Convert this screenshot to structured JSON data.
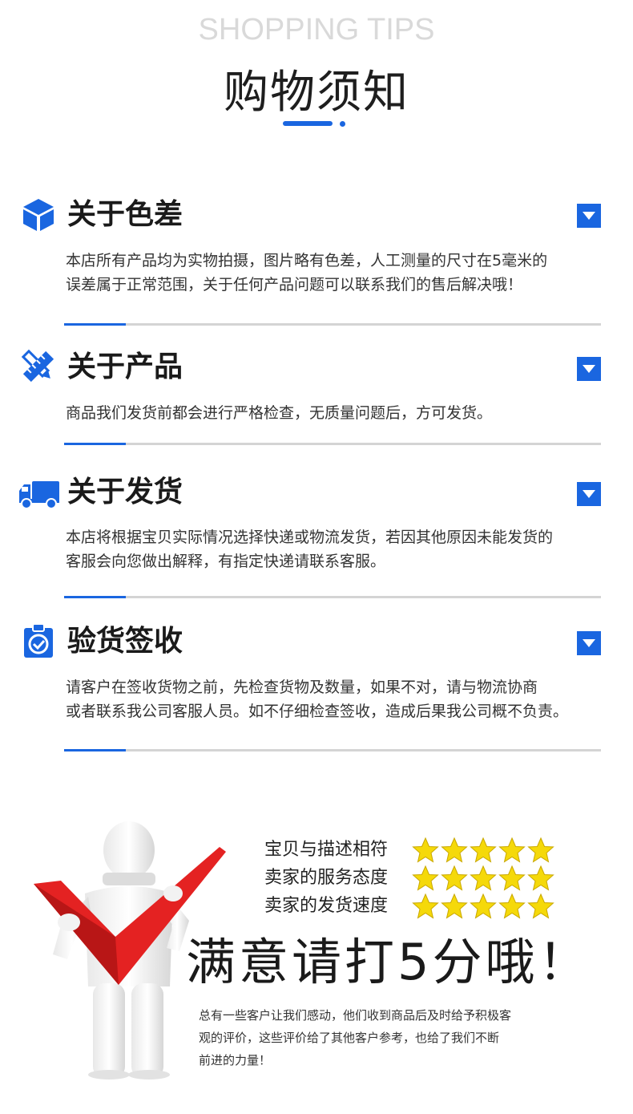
{
  "header": {
    "title_en": "SHOPPING TIPS",
    "title_cn": "购物须知"
  },
  "sections": [
    {
      "title": "关于色差",
      "icon": "cube-icon",
      "lines": [
        "本店所有产品均为实物拍摄，图片略有色差，人工测量的尺寸在5毫米的",
        "误差属于正常范围，关于任何产品问题可以联系我们的售后解决哦！"
      ]
    },
    {
      "title": "关于产品",
      "icon": "pencil-ruler-icon",
      "lines": [
        "商品我们发货前都会进行严格检查，无质量问题后，方可发货。"
      ]
    },
    {
      "title": "关于发货",
      "icon": "truck-icon",
      "lines": [
        "本店将根据宝贝实际情况选择快递或物流发货，若因其他原因未能发货的",
        "客服会向您做出解释，有指定快递请联系客服。"
      ]
    },
    {
      "title": "验货签收",
      "icon": "clipboard-check-icon",
      "lines": [
        "请客户在签收货物之前，先检查货物及数量，如果不对，请与物流协商",
        "或者联系我公司客服人员。如不仔细检查签收，造成后果我公司概不负责。"
      ]
    }
  ],
  "ratings": [
    {
      "label": "宝贝与描述相符",
      "stars": 5
    },
    {
      "label": "卖家的服务态度",
      "stars": 5
    },
    {
      "label": "卖家的发货速度",
      "stars": 5
    }
  ],
  "cta": "满意请打5分哦！",
  "footnote": [
    "总有一些客户让我们感动，他们收到商品后及时给予积极客",
    "观的评价，这些评价给了其他客户参考，也给了我们不断",
    "前进的力量！"
  ],
  "colors": {
    "accent": "#1a66e0",
    "star": "#f5d90a",
    "check": "#e02020"
  }
}
